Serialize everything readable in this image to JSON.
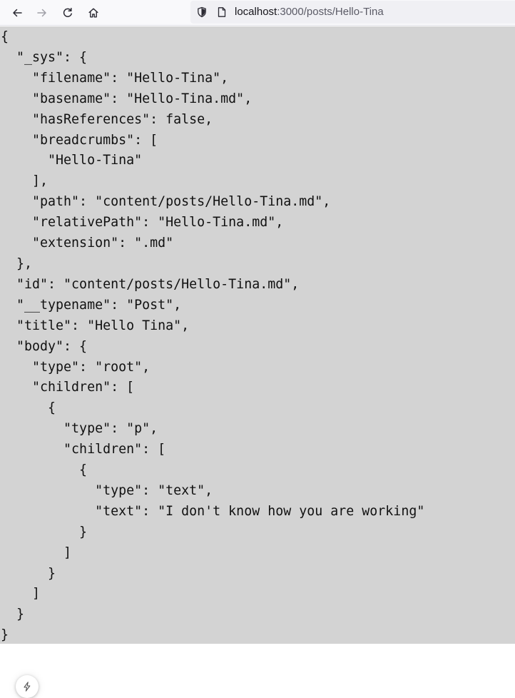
{
  "browser": {
    "url_host": "localhost",
    "url_rest": ":3000/posts/Hello-Tina"
  },
  "page": {
    "json_text": "{\n  \"_sys\": {\n    \"filename\": \"Hello-Tina\",\n    \"basename\": \"Hello-Tina.md\",\n    \"hasReferences\": false,\n    \"breadcrumbs\": [\n      \"Hello-Tina\"\n    ],\n    \"path\": \"content/posts/Hello-Tina.md\",\n    \"relativePath\": \"Hello-Tina.md\",\n    \"extension\": \".md\"\n  },\n  \"id\": \"content/posts/Hello-Tina.md\",\n  \"__typename\": \"Post\",\n  \"title\": \"Hello Tina\",\n  \"body\": {\n    \"type\": \"root\",\n    \"children\": [\n      {\n        \"type\": \"p\",\n        \"children\": [\n          {\n            \"type\": \"text\",\n            \"text\": \"I don't know how you are working\"\n          }\n        ]\n      }\n    ]\n  }\n}"
  },
  "icons": {
    "back": "arrow-left-icon",
    "forward": "arrow-right-icon",
    "reload": "reload-icon",
    "home": "home-icon",
    "shield": "tracking-shield-icon",
    "page": "page-info-icon",
    "badge": "bolt-icon"
  },
  "colors": {
    "content_bg": "#d3d3d3",
    "toolbar_bg": "#f9f9fb",
    "urlbar_bg": "#f0f0f4"
  }
}
